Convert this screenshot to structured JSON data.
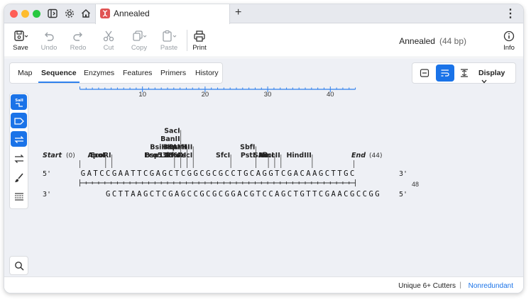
{
  "window": {
    "tab_title": "Annealed",
    "add_tab_glyph": "+",
    "menu_glyph": "⋮",
    "traffic_lights": [
      "#ff5f57",
      "#febc2e",
      "#28c840"
    ]
  },
  "toolbar": {
    "save": "Save",
    "undo": "Undo",
    "redo": "Redo",
    "cut": "Cut",
    "copy": "Copy",
    "paste": "Paste",
    "print": "Print",
    "info": "Info"
  },
  "sequence": {
    "name": "Annealed",
    "length": "(44 bp)"
  },
  "view_tabs": [
    "Map",
    "Sequence",
    "Enzymes",
    "Features",
    "Primers",
    "History"
  ],
  "active_tab": "Sequence",
  "display": {
    "label": "Display"
  },
  "map": {
    "ruler_ticks": [
      "10",
      "20",
      "30",
      "40"
    ],
    "start_label": "Start",
    "start_pos": "(0)",
    "end_label": "End",
    "end_pos": "(44)",
    "prime5": "5'",
    "prime3": "3'",
    "top_strand": "GATCCGAATTCGAGCTCGGCGCGCCTGCAGGTCGACAAGCTTGC",
    "bottom_strand": "GCTTAAGCTCGAGCCGCGCGGACGTCCAGCTGTTCGAACGCCGG",
    "bottom_number": "48",
    "enzymes": [
      {
        "label": "ApoI",
        "site": 4
      },
      {
        "label": "EcoRI",
        "site": 5
      },
      {
        "label": "Eco53kI",
        "site": 15
      },
      {
        "label": "Bsp1286I",
        "site": 16
      },
      {
        "label": "BsiHKAI",
        "site": 16
      },
      {
        "label": "BanII",
        "site": 16
      },
      {
        "label": "SacI",
        "site": 16
      },
      {
        "label": "BfuAI",
        "site": 17
      },
      {
        "label": "BspMI",
        "site": 17
      },
      {
        "label": "AscI",
        "site": 18
      },
      {
        "label": "BssHII",
        "site": 18
      },
      {
        "label": "SfcI",
        "site": 24
      },
      {
        "label": "PstI",
        "site": 28
      },
      {
        "label": "SbfI",
        "site": 28
      },
      {
        "label": "SalI",
        "site": 30
      },
      {
        "label": "AccI",
        "site": 31
      },
      {
        "label": "HincII",
        "site": 32
      },
      {
        "label": "HindIII",
        "site": 37
      }
    ]
  },
  "tools": {
    "sali_tag": "SalI"
  },
  "status": {
    "filter": "Unique 6+ Cutters",
    "separator": "|",
    "mode": "Nonredundant"
  },
  "colors": {
    "accent": "#1a73e8",
    "tab_icon": "#e05454",
    "ruler": "#2f80ed"
  }
}
